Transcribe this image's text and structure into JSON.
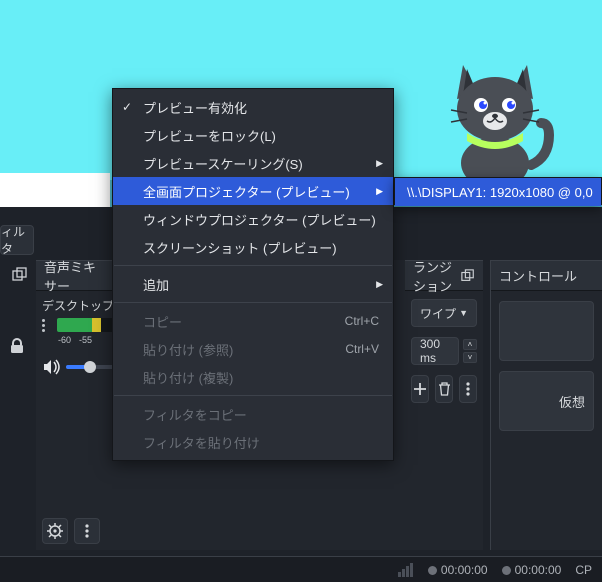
{
  "filters_btn": "ィルタ",
  "mixer": {
    "title": "音声ミキサー",
    "channel_label": "デスクトップ音",
    "db_marks": [
      "-60",
      "-55"
    ]
  },
  "transition": {
    "title": "ランジション",
    "select_value": "ワイプ",
    "duration_value": "300 ms"
  },
  "controls": {
    "title": "コントロール",
    "virtual_cam": "仮想"
  },
  "ctx": {
    "preview_enable": "プレビュー有効化",
    "preview_lock": "プレビューをロック(L)",
    "preview_scaling": "プレビュースケーリング(S)",
    "fullscreen_projector": "全画面プロジェクター (プレビュー)",
    "window_projector": "ウィンドウプロジェクター (プレビュー)",
    "screenshot": "スクリーンショット (プレビュー)",
    "add": "追加",
    "copy": "コピー",
    "copy_shortcut": "Ctrl+C",
    "paste_ref": "貼り付け (参照)",
    "paste_ref_shortcut": "Ctrl+V",
    "paste_dup": "貼り付け (複製)",
    "copy_filters": "フィルタをコピー",
    "paste_filters": "フィルタを貼り付け"
  },
  "submenu": {
    "display1": "\\\\.\\DISPLAY1: 1920x1080 @ 0,0"
  },
  "status": {
    "time1": "00:00:00",
    "time2": "00:00:00",
    "cpu": "CP"
  }
}
